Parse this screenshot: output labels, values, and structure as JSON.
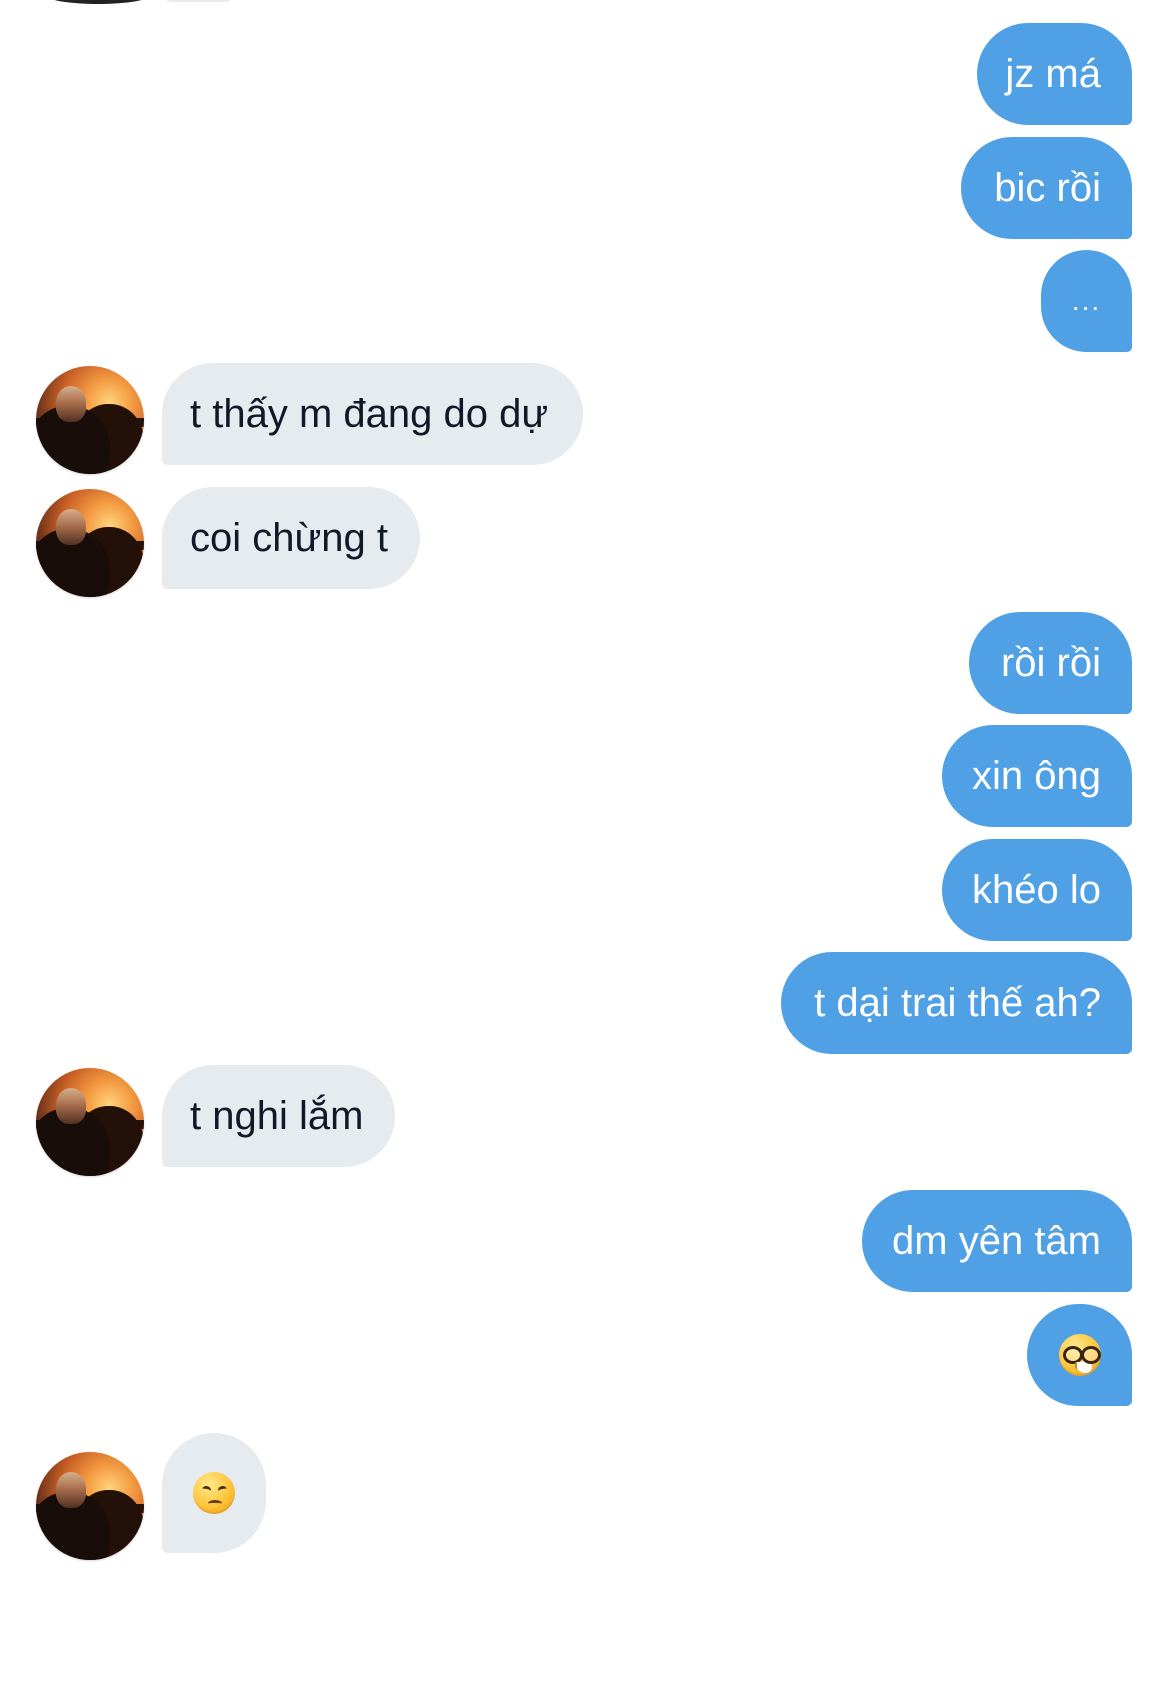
{
  "messages": [
    {
      "text": "jz má"
    },
    {
      "text": "bic rồi"
    },
    {
      "text": "..."
    },
    {
      "text": "t thấy m đang do dự"
    },
    {
      "text": "coi chừng t"
    },
    {
      "text": "rồi rồi"
    },
    {
      "text": "xin ông"
    },
    {
      "text": "khéo lo"
    },
    {
      "text": "t dại trai thế ah?"
    },
    {
      "text": "t nghi lắm"
    },
    {
      "text": "dm yên tâm"
    },
    {
      "text": "🤓",
      "icon": "nerd-face-icon"
    },
    {
      "text": "😒",
      "icon": "unamused-face-icon"
    }
  ],
  "colors": {
    "outgoing_bubble": "#50a0e6",
    "incoming_bubble": "#e6ebf0",
    "background": "#ffffff"
  }
}
